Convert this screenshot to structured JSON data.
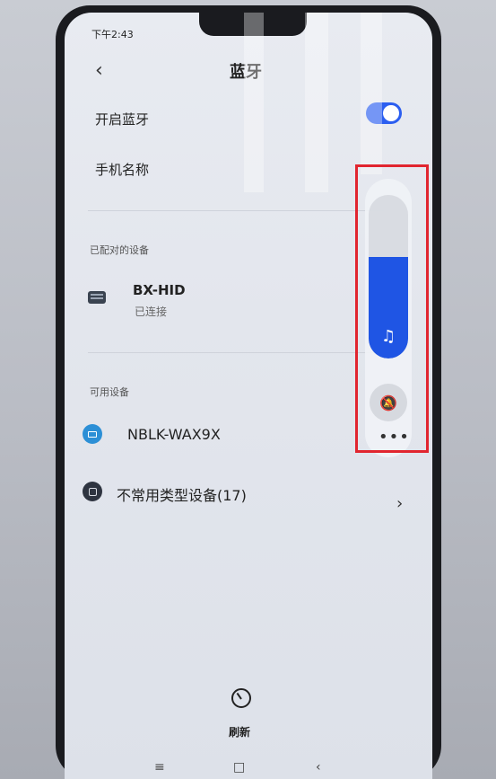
{
  "status_bar": {
    "time": "下午2:43"
  },
  "header": {
    "title": "蓝牙",
    "back_icon": "chevron-left-icon"
  },
  "settings": {
    "bluetooth_toggle_label": "开启蓝牙",
    "bluetooth_enabled": true,
    "phone_name_label": "手机名称",
    "phone_name_value": ""
  },
  "paired_section": {
    "title": "已配对的设备",
    "devices": [
      {
        "name": "BX-HID",
        "status": "已连接",
        "icon": "keyboard-icon"
      }
    ]
  },
  "available_section": {
    "title": "可用设备",
    "devices": [
      {
        "name": "NBLK-WAX9X",
        "icon": "laptop-icon"
      },
      {
        "name": "不常用类型设备(17)",
        "icon": "device-box-icon"
      }
    ]
  },
  "volume_panel": {
    "level_percent": 62,
    "icons": [
      "music-note-icon",
      "bell-muted-icon",
      "more-icon"
    ],
    "accent_color": "#1f55e4",
    "highlight_color": "#e1252f"
  },
  "refresh": {
    "label": "刷新",
    "icon": "refresh-icon"
  }
}
